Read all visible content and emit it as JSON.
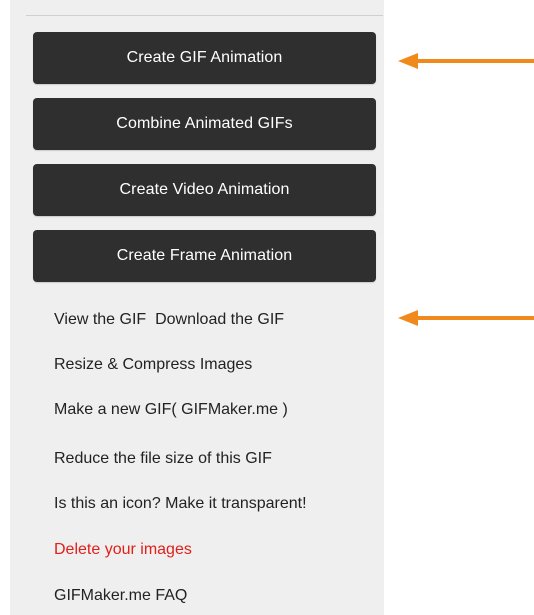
{
  "buttons": {
    "create_gif": "Create GIF Animation",
    "combine_gifs": "Combine Animated GIFs",
    "create_video": "Create Video Animation",
    "create_frame": "Create Frame Animation"
  },
  "links": {
    "view_gif": "View the GIF",
    "download_gif": "Download the GIF",
    "resize_compress": "Resize & Compress Images",
    "make_new_gif": "Make a new GIF( GIFMaker.me )",
    "reduce_size": "Reduce the file size of this GIF",
    "icon_transparent": "Is this an icon? Make it transparent!",
    "delete_images": "Delete your images",
    "faq": "GIFMaker.me FAQ"
  },
  "colors": {
    "button_bg": "#2f2f2f",
    "panel_bg": "#efefef",
    "arrow": "#f08a1c",
    "delete_link": "#e0201b"
  },
  "icons": {
    "annotation_arrow": "arrow-left-icon"
  }
}
